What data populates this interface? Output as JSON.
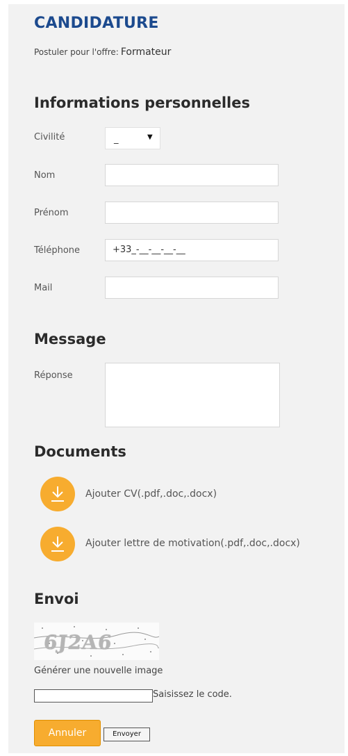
{
  "header": {
    "title": "CANDIDATURE",
    "subtitle_prefix": "Postuler pour l'offre:",
    "job_title": "Formateur"
  },
  "sections": {
    "personal": "Informations personnelles",
    "message": "Message",
    "documents": "Documents",
    "envoi": "Envoi"
  },
  "fields": {
    "civilite": {
      "label": "Civilité",
      "value": "_"
    },
    "nom": {
      "label": "Nom",
      "value": ""
    },
    "prenom": {
      "label": "Prénom",
      "value": ""
    },
    "telephone": {
      "label": "Téléphone",
      "value": "+33_-__-__-__-__"
    },
    "mail": {
      "label": "Mail",
      "value": ""
    },
    "reponse": {
      "label": "Réponse",
      "value": ""
    }
  },
  "documents": [
    {
      "label": "Ajouter CV(.pdf,.doc,.docx)",
      "icon": "download-icon"
    },
    {
      "label": "Ajouter lettre de motivation(.pdf,.doc,.docx)",
      "icon": "download-icon"
    }
  ],
  "captcha": {
    "code": "6J2A6",
    "regenerate": "Générer une nouvelle image",
    "input_label": "Saisissez le code.",
    "input_value": ""
  },
  "buttons": {
    "cancel": "Annuler",
    "send": "Envoyer"
  },
  "colors": {
    "title": "#1c4a8e",
    "accent": "#f7ac2f"
  }
}
